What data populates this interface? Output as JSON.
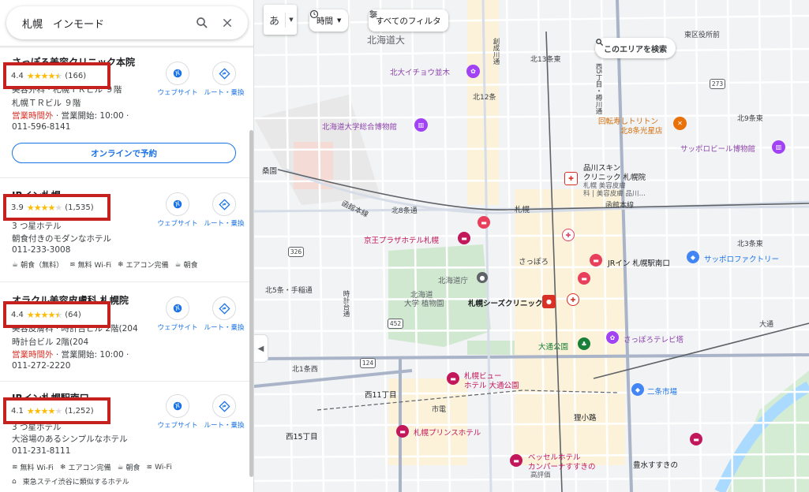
{
  "search": {
    "query": "札幌　インモード"
  },
  "actions": {
    "website": "ウェブサイト",
    "route": "ルート・乗換"
  },
  "results": [
    {
      "title": "さっぽろ美容クリニック本院",
      "rating": "4.4",
      "stars": 4.5,
      "reviews": "(166)",
      "lines": [
        "美容外科 · 札幌ＴＲビル ９階",
        "札幌ＴＲビル ９階"
      ],
      "status_closed": "営業時間外",
      "status_open": " · 営業開始: 10:00 ·",
      "phone": "011-596-8141",
      "reserve": "オンラインで予約"
    },
    {
      "title": "JRイン札幌",
      "rating": "3.9",
      "stars": 4,
      "reviews": "(1,535)",
      "line1": "3 つ星ホテル",
      "desc": "朝食付きのモダンなホテル",
      "phone": "011-233-3008",
      "amenities": [
        "朝食（無料）",
        "無料 Wi-Fi",
        "エアコン完備",
        "朝食"
      ]
    },
    {
      "title": "オラクル美容皮膚科 札幌院",
      "rating": "4.4",
      "stars": 4.5,
      "reviews": "(64)",
      "lines": [
        "美容皮膚科 · 時計台ビル 2階(204"
      ],
      "line2": "時計台ビル 2階(204",
      "status_closed": "営業時間外",
      "status_open": " · 営業開始: 10:00 ·",
      "phone": "011-272-2220"
    },
    {
      "title": "JRイン札幌駅南口",
      "rating": "4.1",
      "stars": 4,
      "reviews": "(1,252)",
      "line1": "3 つ星ホテル",
      "desc": "大浴場のあるシンプルなホテル",
      "phone": "011-231-8111",
      "amenities": [
        "無料 Wi-Fi",
        "エアコン完備",
        "朝食",
        "Wi-Fi"
      ],
      "note": "東急ステイ渋谷に類似するホテル"
    }
  ],
  "map": {
    "lang": "あ",
    "chips": {
      "time": "時間",
      "filters": "すべてのフィルタ"
    },
    "search_area": "このエリアを検索",
    "labels": {
      "hokudai": "北海道大",
      "ginkgo": "北大イチョウ並木",
      "kita13e": "北13条東",
      "kita12": "北12条",
      "museum": "北海道大学総合博物館",
      "kaitenzushi": "回転寿しトリトン",
      "kita8": "北8条光星店",
      "beer": "サッポロビール博物館",
      "higashiku": "東区役所前",
      "kuwazono": "桑園",
      "shinagawa1": "品川スキン",
      "shinagawa2": "クリニック 札幌院",
      "shinagawa3": "札幌 美容皮膚",
      "shinagawa4": "科 | 美容皮膚 品川…",
      "kita8jo": "北8条通",
      "sapporo_sta": "札幌",
      "keio": "京王プラザホテル札幌",
      "hakodate": "函館本線",
      "sapporo": "さっぽろ",
      "jrinn": "JRイン 札幌駅南口",
      "factory": "サッポロファクトリー",
      "chocho": "北海道庁",
      "botanic1": "北海道",
      "botanic2": "大学 植物園",
      "seeds": "札幌シーズクリニック",
      "kita5": "北5条・手稲通",
      "ohdori": "大通公園",
      "tvtower": "さっぽろテレビ塔",
      "kita1": "北1条西",
      "view1": "札幌ビュー",
      "view2": "ホテル 大通公園",
      "nishi11": "西11丁目",
      "nijo": "二条市場",
      "shiden": "市電",
      "tanuki": "狸小路",
      "nishi15": "西15丁目",
      "prince": "札幌プリンスホテル",
      "vessel1": "ベッセルホテル",
      "vessel2": "カンパーナすすきの",
      "vessel3": "高評価",
      "toyohira": "豊水すすきの",
      "kita9e": "北9条東",
      "kita3e": "北3条東",
      "odori_e": "大通",
      "r273": "273",
      "r326": "326",
      "r452": "452",
      "r124": "124",
      "jozan": "創成川通",
      "nishi_st": "西5丁目・樽川通",
      "tokei": "時計台通"
    }
  }
}
